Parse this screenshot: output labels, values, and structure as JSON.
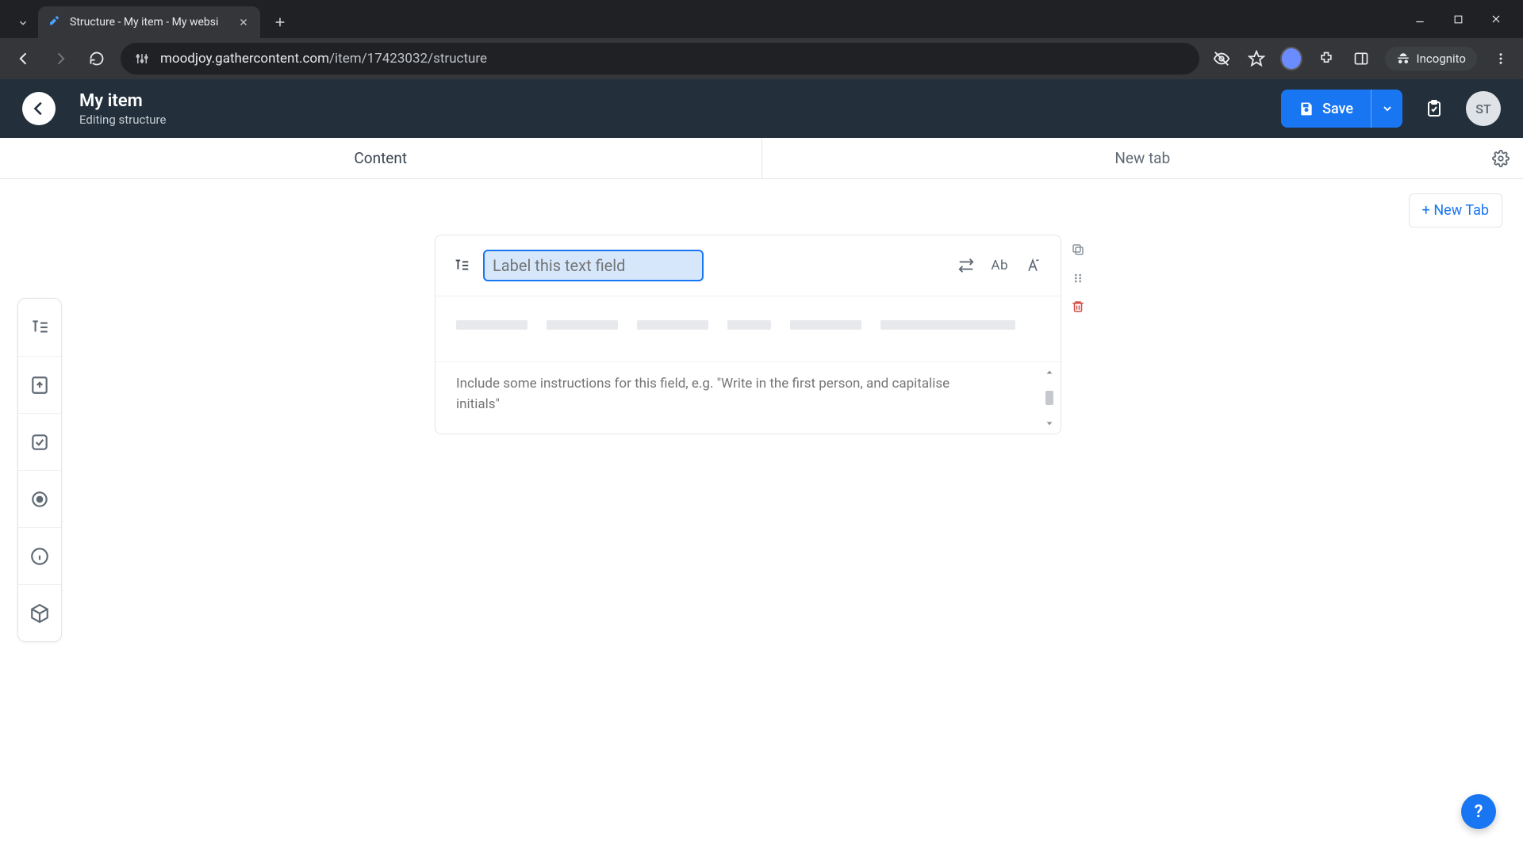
{
  "browser": {
    "tab_title": "Structure - My item - My websi",
    "url_host": "moodjoy.gathercontent.com",
    "url_path": "/item/17423032/structure",
    "incognito_label": "Incognito"
  },
  "header": {
    "title": "My item",
    "subtitle": "Editing structure",
    "save_label": "Save",
    "avatar_initials": "ST"
  },
  "doc_tabs": {
    "tab1": "Content",
    "tab2": "New tab",
    "new_tab_button": "+ New Tab"
  },
  "field": {
    "label_placeholder": "Label this text field",
    "ab_toggle": "Ab",
    "instructions_placeholder": "Include some instructions for this field, e.g. \"Write in the first person, and capitalise initials\""
  },
  "help": {
    "label": "?"
  },
  "colors": {
    "accent": "#1976f2",
    "danger": "#d24a43",
    "header_bg": "#23303c"
  }
}
